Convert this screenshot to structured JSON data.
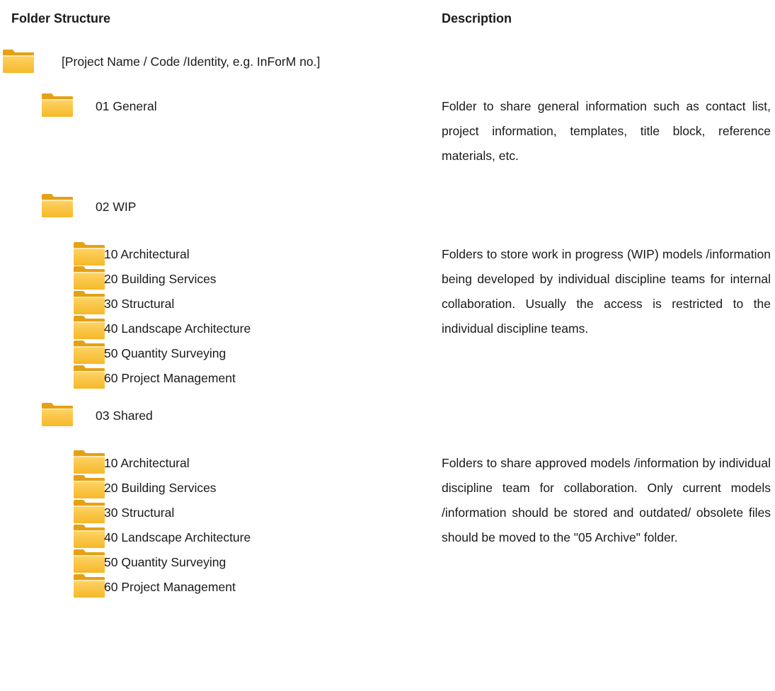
{
  "headers": {
    "folder": "Folder Structure",
    "description": "Description"
  },
  "colors": {
    "folder_main": "#f5b829",
    "folder_tab": "#e6a015",
    "folder_light": "#ffd467"
  },
  "icon": "folder-icon",
  "root": {
    "label": "[Project Name / Code /Identity, e.g. InForM no.]"
  },
  "general": {
    "label": "01 General",
    "description": "Folder to share general information such as contact list, project information, templates, title block, reference materials, etc."
  },
  "wip": {
    "label": "02 WIP",
    "children": [
      "10 Architectural",
      "20 Building Services",
      "30 Structural",
      "40 Landscape Architecture",
      "50 Quantity Surveying",
      "60 Project Management"
    ],
    "description": "Folders to store work in progress (WIP) models /information being developed by individual discipline teams for internal collaboration. Usually the access is restricted to the individual discipline teams."
  },
  "shared": {
    "label": "03 Shared",
    "children": [
      "10 Architectural",
      "20 Building Services",
      "30 Structural",
      "40 Landscape Architecture",
      "50 Quantity Surveying",
      "60 Project Management"
    ],
    "description": "Folders to share approved models /information by individual discipline team for collaboration. Only current models /information should be stored and outdated/ obsolete files should be moved to the \"05 Archive\" folder."
  }
}
